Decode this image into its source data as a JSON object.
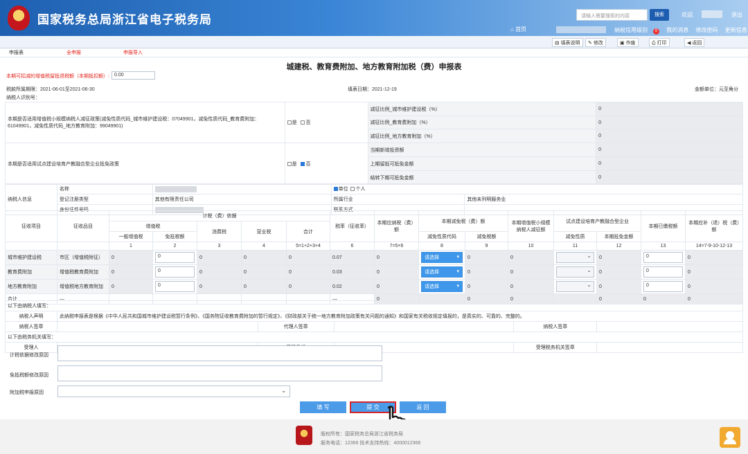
{
  "header": {
    "title": "国家税务总局浙江省电子税务局",
    "search_placeholder": "请输入需要搜索的内容",
    "search_button": "搜索",
    "welcome": "欢迎,",
    "logout": "退出",
    "home": "首页",
    "nav": [
      "纳税信用级别",
      "我的消息",
      "修改密码",
      "更新信息"
    ],
    "nav_badge": "0"
  },
  "toolbar": {
    "tabs": [
      "申报表",
      "全申报",
      "申报导入"
    ],
    "buttons": [
      "填表说明",
      "修改",
      "作废",
      "打印",
      "返回"
    ]
  },
  "form": {
    "title": "城建税、教育费附加、地方教育附加税（费）申报表",
    "deduct_label": "本期可扣减的增值税留抵退税额（本期抵扣额）:",
    "deduct_value": "0.00",
    "period": "税款所属期限：2021-06-01至2021-06-30",
    "fill_date": "填表日期：2021-12-19",
    "unit": "金额单位：元至角分",
    "taxpayer_id_label": "纳税人识别号：",
    "q1": "本期是否适用增值税小规模纳税人减征政策(减免性质代码_城市维护建设税：07049901，减免性质代码_教育费附加：61049901，减免性质代码_地方教育附加：99049901)",
    "q2": "本期是否适用试点建设培育产教融合型企业抵免政策",
    "yes": "是",
    "no": "否",
    "q1_right": [
      {
        "label": "减征比例_城市维护建设税（%）",
        "value": "0"
      },
      {
        "label": "减征比例_教育费附加（%）",
        "value": "0"
      },
      {
        "label": "减征比例_地方教育附加（%）",
        "value": "0"
      }
    ],
    "q2_right": [
      {
        "label": "当期新增投资额",
        "value": "0"
      },
      {
        "label": "上期留抵可抵免金额",
        "value": "0"
      },
      {
        "label": "结转下期可抵免金额",
        "value": "0"
      }
    ],
    "info": {
      "section": "纳税人信息",
      "name": "名称",
      "reg_type": "登记注册类型",
      "reg_type_value": "其他有限责任公司",
      "id_doc": "身份证件号码",
      "unit": "单位",
      "person": "个人",
      "industry": "所属行业",
      "industry_value": "其他未列明服务业",
      "contact": "联系方式"
    },
    "head": {
      "item": "征收项目",
      "subitem": "征收品目",
      "basis": "计税（费）依据",
      "vat": "增值税",
      "vat_general": "一般增值税",
      "vat_exempt": "免抵税额",
      "consumption": "消费税",
      "business": "营业税",
      "total": "合计",
      "rate": "税率（征收率）",
      "payable": "本期应纳税（费）额",
      "reduce": "本期减免税（费）额",
      "reduce_code": "减免性质代码",
      "reduce_amount": "减免税额",
      "small": "本期增值税小规模纳税人减征额",
      "pilot": "试点建设培育产教融合型企业",
      "pilot_code": "减免性质",
      "pilot_amount": "本期抵免金额",
      "paid": "本期已缴税额",
      "refund": "本期应补（退）税（费）额",
      "nums": [
        "1",
        "2",
        "3",
        "4",
        "5=1+2+3+4",
        "6",
        "7=5×6",
        "8",
        "9",
        "10",
        "11",
        "12",
        "13",
        "14=7-9-10-12-13"
      ]
    },
    "rows": [
      {
        "item": "城市维护建设税",
        "sub": "市区（增值税附征）",
        "v1": "0",
        "v2": "0",
        "v3": "0",
        "v4": "0",
        "v5": "0",
        "rate": "0.07",
        "v7": "0",
        "sel": "请选择",
        "v9": "0",
        "v10": "0",
        "v12": "0",
        "v13": "0",
        "v14": "0"
      },
      {
        "item": "教育费附加",
        "sub": "增值税教育费附加",
        "v1": "0",
        "v2": "0",
        "v3": "0",
        "v4": "0",
        "v5": "0",
        "rate": "0.03",
        "v7": "0",
        "sel": "请选择",
        "v9": "0",
        "v10": "0",
        "v12": "0",
        "v13": "0",
        "v14": "0"
      },
      {
        "item": "地方教育附加",
        "sub": "增值税地方教育附加",
        "v1": "0",
        "v2": "0",
        "v3": "0",
        "v4": "0",
        "v5": "0",
        "rate": "0.02",
        "v7": "0",
        "sel": "请选择",
        "v9": "0",
        "v10": "0",
        "v12": "0",
        "v13": "0",
        "v14": "0"
      }
    ],
    "total_row": {
      "label": "合计",
      "dash1": "—",
      "dash2": "—",
      "v7": "0",
      "v9": "0",
      "v10": "0",
      "v12": "0",
      "v13": "0",
      "v14": "0"
    },
    "taxpayer_fill": "以下由纳税人填写：",
    "declare_label": "纳税人声明",
    "declare_text": "此纳税申报表是根据《中华人民共和国城市维护建设税暂行条例》、《国务院征收教育费附加的暂行规定》、《财政部关于统一地方教育附加政策有关问题的通知》和国家有关税收规定填报的，是真实的、可靠的、完整的。",
    "sign_taxpayer": "纳税人签章",
    "sign_agent": "代理人签章",
    "sign_taxpayer2": "纳税人签章",
    "tax_fill": "以下由税务机关填写：",
    "handler": "受理人",
    "handle_date": "受理日期",
    "handle_seal": "受理税务机关签章",
    "reason1": "计税依据修改原因",
    "reason2": "免抵税额修改原因",
    "reason3": "附加税申报原因"
  },
  "actions": {
    "fill": "填 写",
    "submit": "提 交",
    "back": "返 回"
  },
  "footer": {
    "line1": "版权所有：国家税务总局浙江省税务局",
    "line2": "服务电话：12366  技术支持热线：4000012366"
  }
}
